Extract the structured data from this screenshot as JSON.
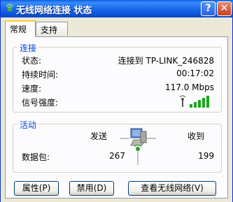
{
  "window": {
    "title": "无线网络连接 状态",
    "help_label": "?",
    "close_label": "✕"
  },
  "tabs": [
    {
      "label": "常规"
    },
    {
      "label": "支持"
    }
  ],
  "connection": {
    "group_title": "连接",
    "status_label": "状态:",
    "status_value": "连接到 TP-LINK_246828",
    "duration_label": "持续时间:",
    "duration_value": "00:17:02",
    "speed_label": "速度:",
    "speed_value": "117.0 Mbps",
    "signal_label": "信号强度:",
    "signal_bars": 5,
    "signal_bars_max": 5,
    "signal_color": "#1BA51B"
  },
  "activity": {
    "group_title": "活动",
    "sent_label": "发送",
    "received_label": "收到",
    "packets_label": "数据包:",
    "packets_sent": "267",
    "packets_received": "199",
    "icon": "wireless-computer-icon"
  },
  "buttons": {
    "properties": "属性(P)",
    "disable": "禁用(D)",
    "view_networks": "查看无线网络(V)"
  },
  "colors": {
    "titlebar": "#0A55D8",
    "group_title": "#0046D5",
    "tab_highlight": "#FFC83C"
  }
}
